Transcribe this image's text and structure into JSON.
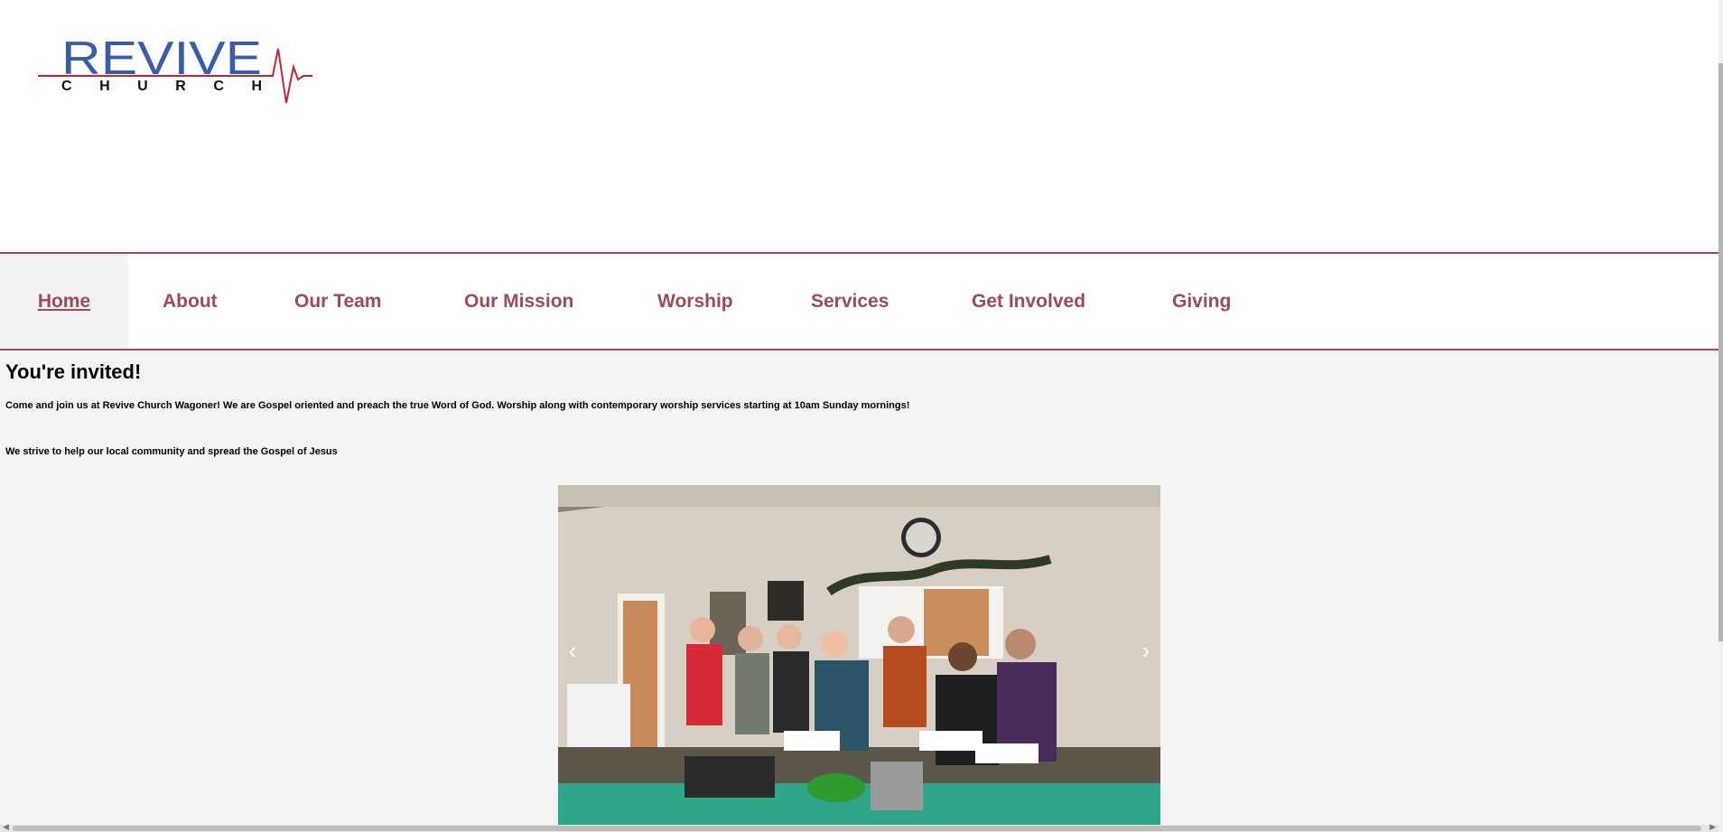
{
  "logo": {
    "text": "REVIVE",
    "subtext": "CHURCH",
    "primary_color": "#3b5da8",
    "accent_color": "#c1272d"
  },
  "nav": {
    "items": [
      {
        "label": "Home",
        "active": true
      },
      {
        "label": "About"
      },
      {
        "label": "Our Team"
      },
      {
        "label": "Our Mission"
      },
      {
        "label": "Worship"
      },
      {
        "label": "Services"
      },
      {
        "label": "Get Involved"
      },
      {
        "label": "Giving"
      }
    ]
  },
  "main": {
    "headline": "You're invited!",
    "paragraph1": "Come and join us at Revive Church Wagoner! We are Gospel oriented and preach the true Word of God. Worship along with contemporary worship services starting at 10am Sunday mornings!",
    "paragraph2": "We strive to help our local community and spread the Gospel of Jesus"
  },
  "slideshow": {
    "prev_icon": "‹",
    "next_icon": "›"
  },
  "colors": {
    "brand": "#9e4a5a",
    "background": "#f4f4f4"
  }
}
